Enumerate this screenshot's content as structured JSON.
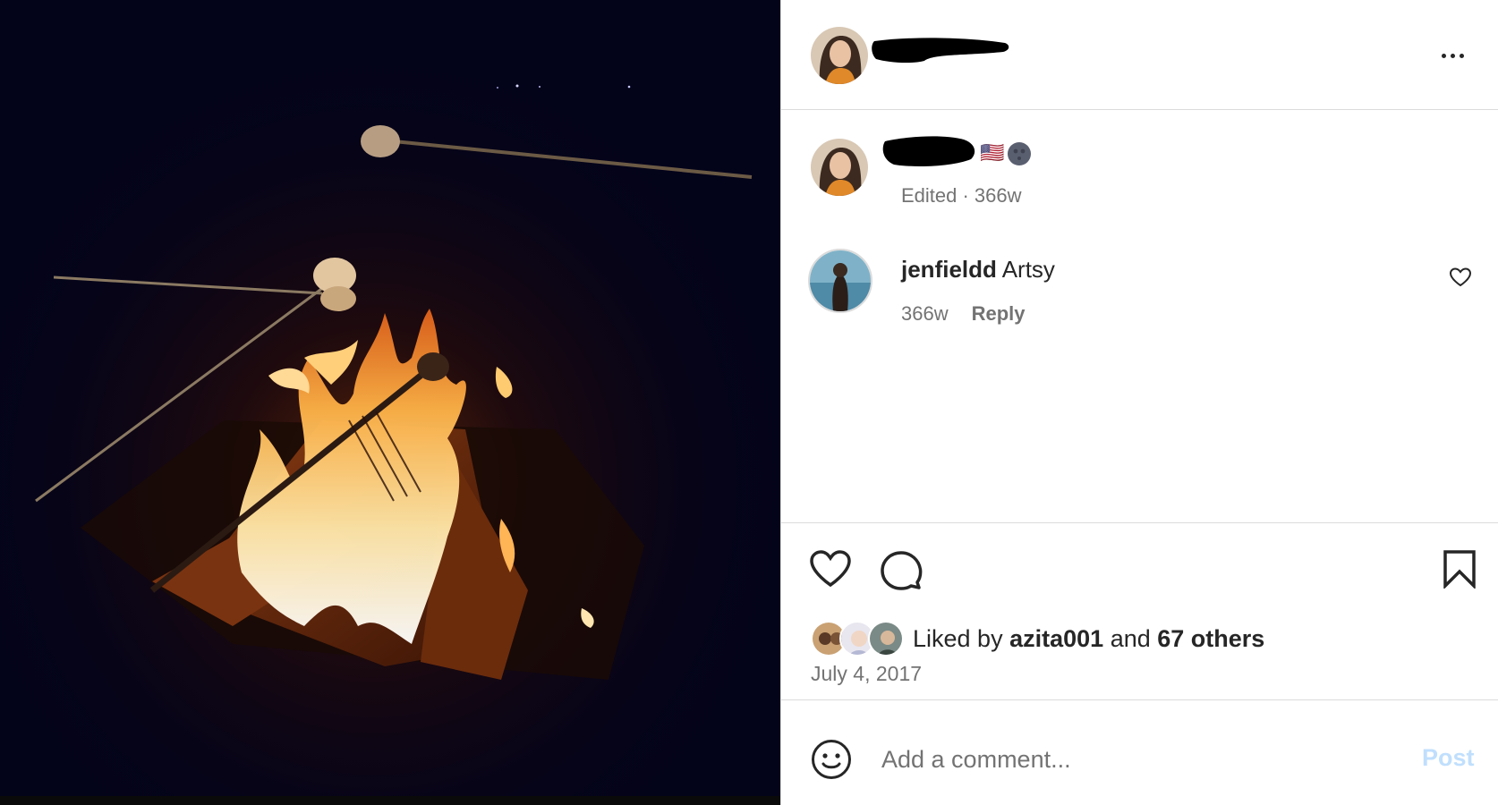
{
  "post": {
    "photo_alt": "campfire"
  },
  "header": {
    "more_icon": "more-horizontal-icon"
  },
  "caption": {
    "flag_emoji": "🇺🇸",
    "meta": "Edited · 366w"
  },
  "comment": {
    "username": "jenfieldd",
    "text": "Artsy",
    "time": "366w",
    "reply_label": "Reply"
  },
  "actions": {
    "like_icon": "heart-icon",
    "comment_icon": "comment-bubble-icon",
    "save_icon": "bookmark-icon"
  },
  "likes": {
    "prefix": "Liked by",
    "user": "azita001",
    "conjunction": "and",
    "others": "67 others"
  },
  "date": "July 4, 2017",
  "add_comment": {
    "placeholder": "Add a comment...",
    "post_label": "Post",
    "emoji_icon": "smiley-icon"
  },
  "colors": {
    "text": "#262626",
    "muted": "#737373",
    "divider": "#dbdbdb",
    "post_disabled": "#c0dffd"
  }
}
